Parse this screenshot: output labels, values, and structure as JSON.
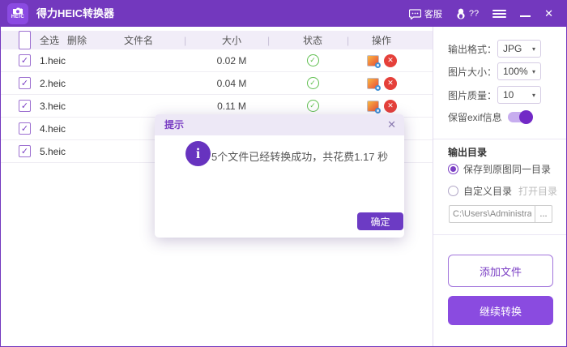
{
  "titlebar": {
    "logo_text": "HEIC",
    "title": "得力HEIC转换器",
    "service_label": "客服",
    "qq_label": "??"
  },
  "table": {
    "header": {
      "select_all": "全选",
      "delete": "删除",
      "filename": "文件名",
      "size": "大小",
      "status": "状态",
      "actions": "操作",
      "separator": "|"
    },
    "rows": [
      {
        "name": "1.heic",
        "size": "0.02 M"
      },
      {
        "name": "2.heic",
        "size": "0.04 M"
      },
      {
        "name": "3.heic",
        "size": "0.11 M"
      },
      {
        "name": "4.heic",
        "size": ""
      },
      {
        "name": "5.heic",
        "size": ""
      }
    ]
  },
  "dialog": {
    "title": "提示",
    "message": "5个文件已经转换成功，共花费1.17 秒",
    "ok_label": "确定"
  },
  "sidebar": {
    "output_format_label": "输出格式：",
    "output_format_value": "JPG",
    "image_size_label": "图片大小：",
    "image_size_value": "100%",
    "image_quality_label": "图片质量：",
    "image_quality_value": "10",
    "exif_label": "保留exif信息",
    "output_dir_title": "输出目录",
    "radio_same_dir_label": "保存到原图同一目录",
    "radio_custom_dir_label": "自定义目录",
    "open_dir_label": "打开目录",
    "path_value": "C:\\Users\\Administra",
    "browse_label": "...",
    "add_files_label": "添加文件",
    "continue_label": "继续转换"
  },
  "icons": {
    "check": "✓",
    "close": "✕",
    "caret": "▾"
  },
  "colors": {
    "titlebar": "#7338be",
    "accent": "#7b3fc4",
    "continue_button": "#8a4be0",
    "ok_button": "#6c3bc4",
    "success": "#5fbf4f",
    "danger": "#e5403a",
    "toggle_on": "#7229c6"
  }
}
